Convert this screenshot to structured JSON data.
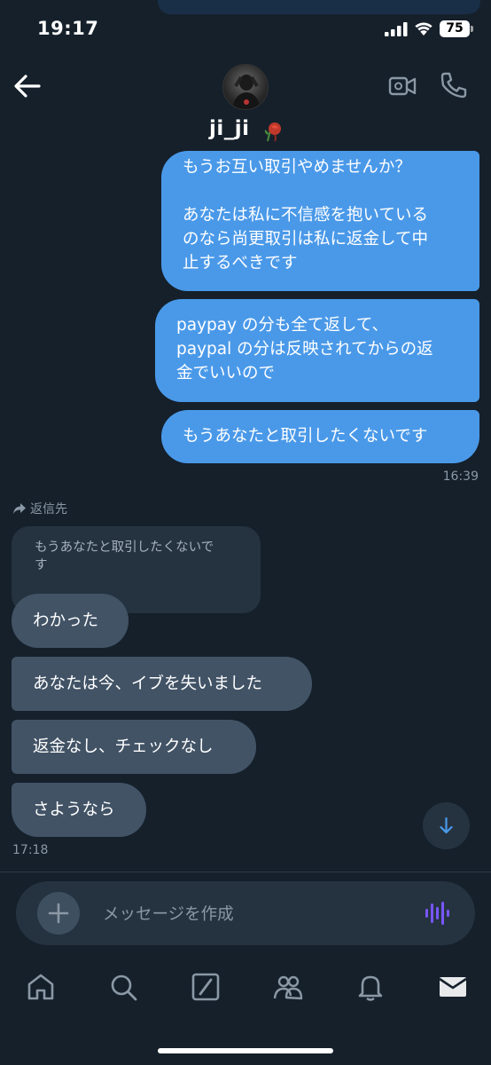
{
  "status_bar": {
    "time": "19:17",
    "battery": "75"
  },
  "header": {
    "name": "ji_ji"
  },
  "messages_sent": [
    {
      "text": "もうお互い取引やめませんか？\n\nあなたは私に不信感を抱いている\nのなら尚更取引は私に返金して中\n止するべきです"
    },
    {
      "text": "paypay の分も全て返して、\npaypal の分は反映されてからの返\n金でいいので"
    },
    {
      "text": "もうあなたと取引したくないです"
    }
  ],
  "sent_time": "16:39",
  "reply": {
    "label": "返信先",
    "quote": "もうあなたと取引したくないで\nす"
  },
  "messages_received": [
    {
      "text": "わかった"
    },
    {
      "text": "あなたは今、イブを失いました"
    },
    {
      "text": "返金なし、チェックなし"
    },
    {
      "text": "さようなら"
    }
  ],
  "received_time": "17:18",
  "composer": {
    "placeholder": "メッセージを作成"
  },
  "colors": {
    "sent_bubble": "#4a99e9",
    "received_bubble": "#425366",
    "background": "#15202b",
    "voice_icon": "#7856ff"
  }
}
